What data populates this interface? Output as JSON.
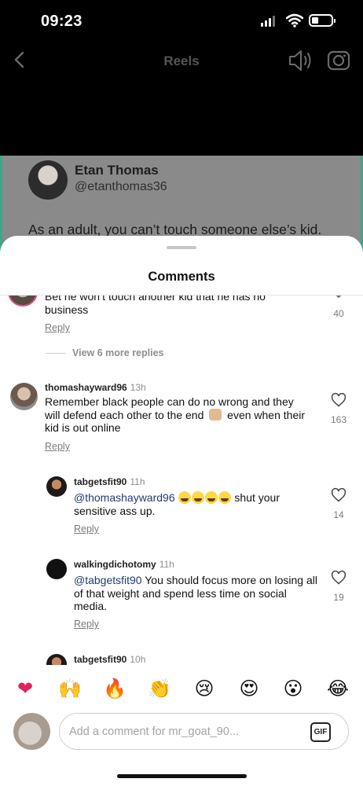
{
  "status_bar": {
    "time": "09:23"
  },
  "header": {
    "title": "Reels"
  },
  "tweet": {
    "name": "Etan Thomas",
    "handle": "@etanthomas36",
    "text": "As an adult, you can’t touch someone else’s kid."
  },
  "sheet": {
    "title": "Comments"
  },
  "comments": [
    {
      "text": "Bet he won’t touch another kid that he has no business",
      "reply_label": "Reply",
      "likes": "40"
    },
    {
      "view_replies_label": "View 6 more replies"
    },
    {
      "username": "thomashayward96",
      "time": "13h",
      "text_part1": "Remember black people can do no wrong and they will defend each other to the end",
      "text_part2": "even when their kid is out online",
      "reply_label": "Reply",
      "likes": "163"
    },
    {
      "username": "tabgetsfit90",
      "time": "11h",
      "mention": "@thomashayward96",
      "text": "shut your sensitive ass up.",
      "reply_label": "Reply",
      "likes": "14"
    },
    {
      "username": "walkingdichotomy",
      "time": "11h",
      "mention": "@tabgetsfit90",
      "text": "You should focus more on losing all of that weight and spend less time on social media.",
      "reply_label": "Reply",
      "likes": "19"
    },
    {
      "username": "tabgetsfit90",
      "time": "10h"
    }
  ],
  "emoji_bar": [
    {
      "name": "heart",
      "glyph": "❤",
      "color": "#e0245e"
    },
    {
      "name": "raised-hands",
      "glyph": "🙌"
    },
    {
      "name": "fire",
      "glyph": "🔥"
    },
    {
      "name": "clapping-hands",
      "glyph": "👏"
    },
    {
      "name": "crying-face",
      "glyph": "😢"
    },
    {
      "name": "heart-eyes",
      "glyph": "😍"
    },
    {
      "name": "surprised-face",
      "glyph": "😮"
    },
    {
      "name": "laughing-face",
      "glyph": "😂"
    }
  ],
  "input": {
    "placeholder": "Add a comment for mr_goat_90...",
    "gif_label": "GIF"
  },
  "colors": {
    "mention": "#223a73",
    "like_count": "#7a7a7a",
    "tweet_border": "#3aa889"
  }
}
